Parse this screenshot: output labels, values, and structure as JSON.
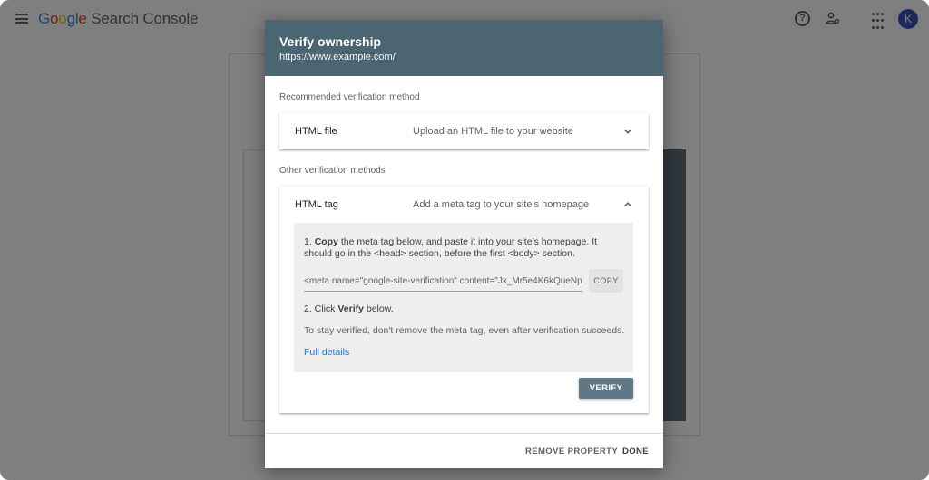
{
  "app": {
    "logo_google": [
      "G",
      "o",
      "o",
      "g",
      "l",
      "e"
    ],
    "logo_product": "Search Console",
    "avatar_initial": "K",
    "icons": [
      "menu-icon",
      "help-icon",
      "manage-users-icon",
      "apps-grid-icon"
    ]
  },
  "dialog": {
    "title": "Verify ownership",
    "url": "https://www.example.com/",
    "recommended_label": "Recommended verification method",
    "other_label": "Other verification methods",
    "html_file": {
      "name": "HTML file",
      "description": "Upload an HTML file to your website",
      "expanded": false
    },
    "html_tag": {
      "name": "HTML tag",
      "description": "Add a meta tag to your site's homepage",
      "expanded": true,
      "step1_num": "1. ",
      "step1_bold": "Copy",
      "step1_rest": " the meta tag below, and paste it into your site's homepage. It should go in the <head> section, before the first <body> section.",
      "meta_tag": "<meta name=\"google-site-verification\" content=\"Jx_Mr5e4K6kQueNp",
      "copy_label": "COPY",
      "step2_prefix": "2. Click ",
      "step2_bold": "Verify",
      "step2_suffix": " below.",
      "stay_verified": "To stay verified, don't remove the meta tag, even after verification succeeds.",
      "full_details": "Full details",
      "verify_label": "VERIFY"
    },
    "footer": {
      "remove_label": "REMOVE PROPERTY",
      "done_label": "DONE"
    }
  },
  "colors": {
    "header": "#4c6572",
    "verify_button": "#5f7886",
    "link": "#1a73e8",
    "avatar": "#3f51b5"
  }
}
